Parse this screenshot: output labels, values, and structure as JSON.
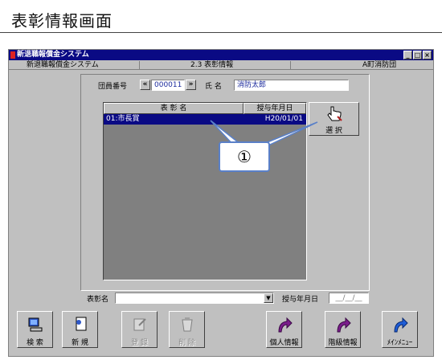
{
  "page": {
    "heading": "表彰情報画面"
  },
  "window": {
    "title": "新退職報償金システム",
    "controls": {
      "minimize": "_",
      "maximize": "□",
      "close": "×"
    }
  },
  "statusbar": {
    "system": "新退職報償金システム",
    "screen": "2.3 表彰情報",
    "org": "A町消防団"
  },
  "form": {
    "member_no_label": "団員番号",
    "member_no": "000011",
    "prev_symbol": "«",
    "next_symbol": "»",
    "name_label": "氏 名",
    "name_value": "消防太郎"
  },
  "grid": {
    "columns": [
      "表 彰 名",
      "授与年月日"
    ],
    "rows": [
      {
        "award": "01:市長賞",
        "date": "H20/01/01"
      }
    ]
  },
  "select_button": {
    "label": "選 択"
  },
  "bottom_form": {
    "award_label": "表彰名",
    "combo_arrow": "▼",
    "date_label": "授与年月日",
    "date_placeholder": "__/__/__"
  },
  "buttons": {
    "search": "検 索",
    "new": "新 規",
    "register": "登 録",
    "delete": "削 除",
    "personal": "個人情報",
    "rank": "階級情報",
    "main_menu": "ﾒｲﾝﾒﾆｭｰ"
  },
  "callout": {
    "label": "①"
  },
  "colors": {
    "titlebar": "#0a0a84",
    "window": "#c0c0c0",
    "selection": "#0a0a84",
    "callout_border": "#5a80c8",
    "nav_arrow": "#7b1e8c"
  },
  "icons": [
    "search-icon",
    "new-document-icon",
    "register-icon",
    "delete-bin-icon",
    "hand-pointer-icon",
    "arrow-forward-icon"
  ]
}
